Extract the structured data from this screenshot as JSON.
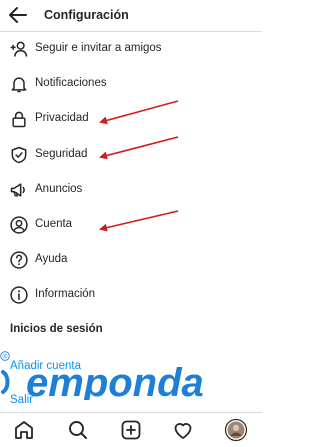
{
  "header": {
    "title": "Configuración"
  },
  "menu": {
    "items": [
      {
        "label": "Seguir e invitar a amigos",
        "icon": "add-person-icon"
      },
      {
        "label": "Notificaciones",
        "icon": "bell-icon"
      },
      {
        "label": "Privacidad",
        "icon": "lock-icon"
      },
      {
        "label": "Seguridad",
        "icon": "shield-check-icon"
      },
      {
        "label": "Anuncios",
        "icon": "megaphone-icon"
      },
      {
        "label": "Cuenta",
        "icon": "account-icon"
      },
      {
        "label": "Ayuda",
        "icon": "help-icon"
      },
      {
        "label": "Información",
        "icon": "info-icon"
      }
    ]
  },
  "login_section": {
    "title": "Inicios de sesión",
    "add_account": "Añadir cuenta",
    "logout": "Salir"
  },
  "watermark": {
    "text": "emponda",
    "mark": "®"
  },
  "colors": {
    "link": "#0095f6",
    "annotation_arrow": "#d01e1e",
    "watermark": "#1d7fd6"
  },
  "tabbar": {
    "items": [
      {
        "icon": "home-icon"
      },
      {
        "icon": "search-icon"
      },
      {
        "icon": "new-post-icon"
      },
      {
        "icon": "heart-icon"
      },
      {
        "icon": "profile-avatar"
      }
    ]
  }
}
